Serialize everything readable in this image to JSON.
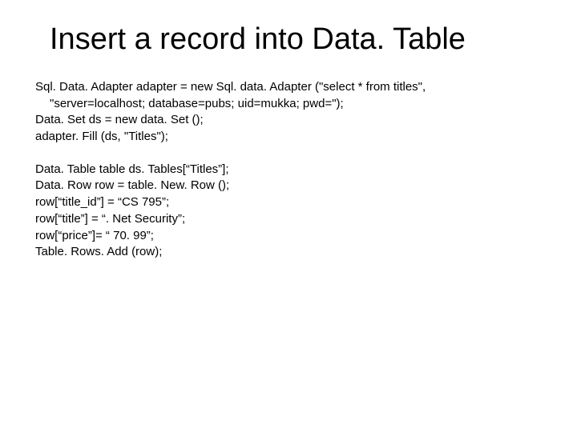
{
  "title": "Insert a record into Data. Table",
  "block1": {
    "l1": "Sql. Data. Adapter adapter = new Sql. data. Adapter (\"select * from titles\",",
    "l2": "\"server=localhost; database=pubs; uid=mukka; pwd=\");",
    "l3": "Data. Set ds = new data. Set ();",
    "l4": "adapter. Fill (ds, \"Titles\");"
  },
  "block2": {
    "l1": "Data. Table table ds. Tables[“Titles”];",
    "l2": "Data. Row row = table. New. Row ();",
    "l3": "row[“title_id”] = “CS 795”;",
    "l4": "row[“title”] = “. Net Security”;",
    "l5": "row[“price”]= “ 70. 99”;",
    "l6": "Table. Rows. Add (row);"
  }
}
